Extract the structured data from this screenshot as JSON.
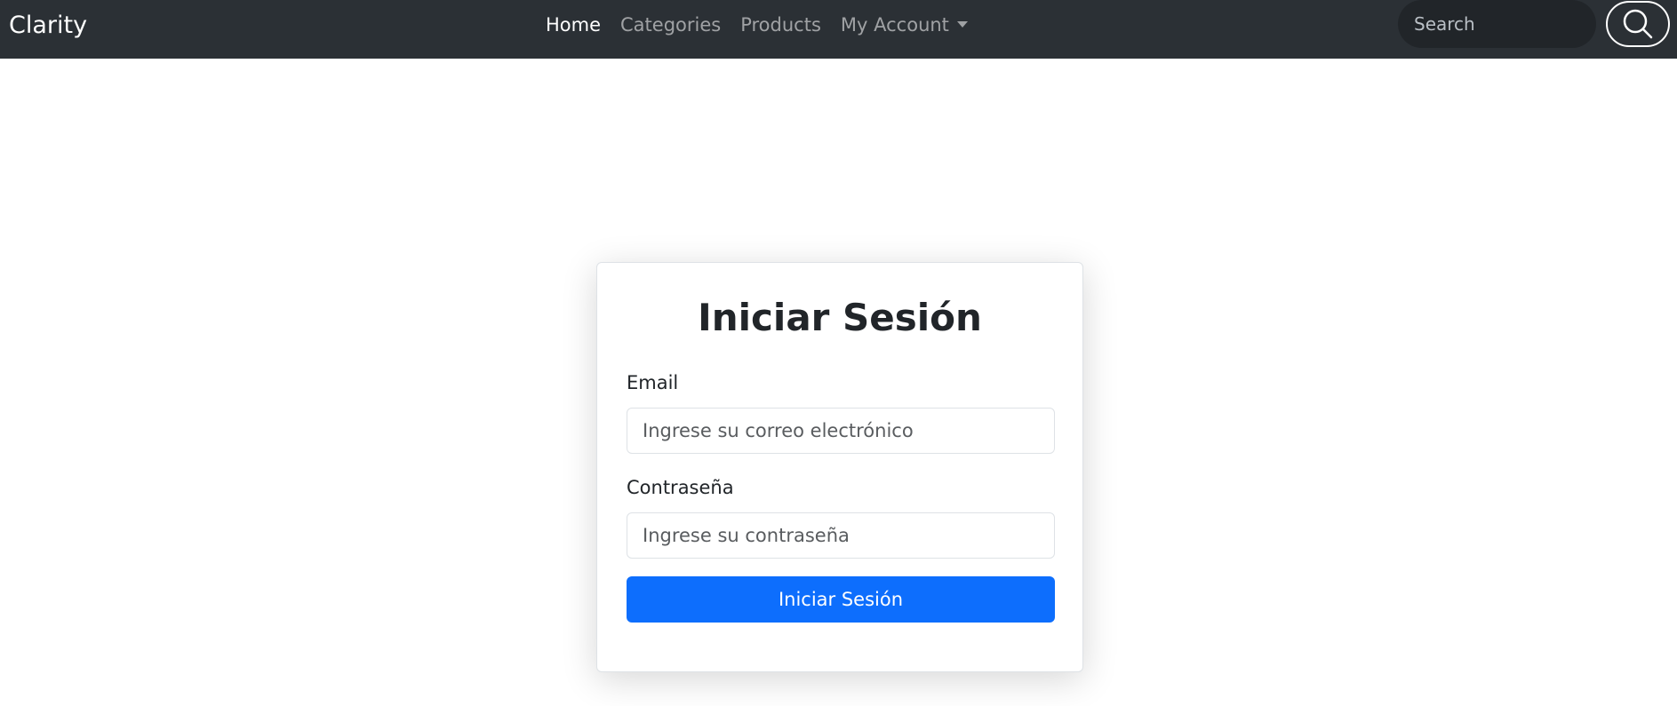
{
  "navbar": {
    "brand": "Clarity",
    "links": [
      {
        "label": "Home",
        "active": true
      },
      {
        "label": "Categories",
        "active": false
      },
      {
        "label": "Products",
        "active": false
      },
      {
        "label": "My Account",
        "active": false,
        "dropdown": true
      }
    ],
    "search_placeholder": "Search",
    "search_icon": "search-icon",
    "background_color": "#2b3035"
  },
  "login": {
    "title": "Iniciar Sesión",
    "email_label": "Email",
    "email_placeholder": "Ingrese su correo electrónico",
    "email_value": "",
    "password_label": "Contraseña",
    "password_placeholder": "Ingrese su contraseña",
    "password_value": "",
    "submit_label": "Iniciar Sesión",
    "submit_color": "#0d6efd"
  }
}
